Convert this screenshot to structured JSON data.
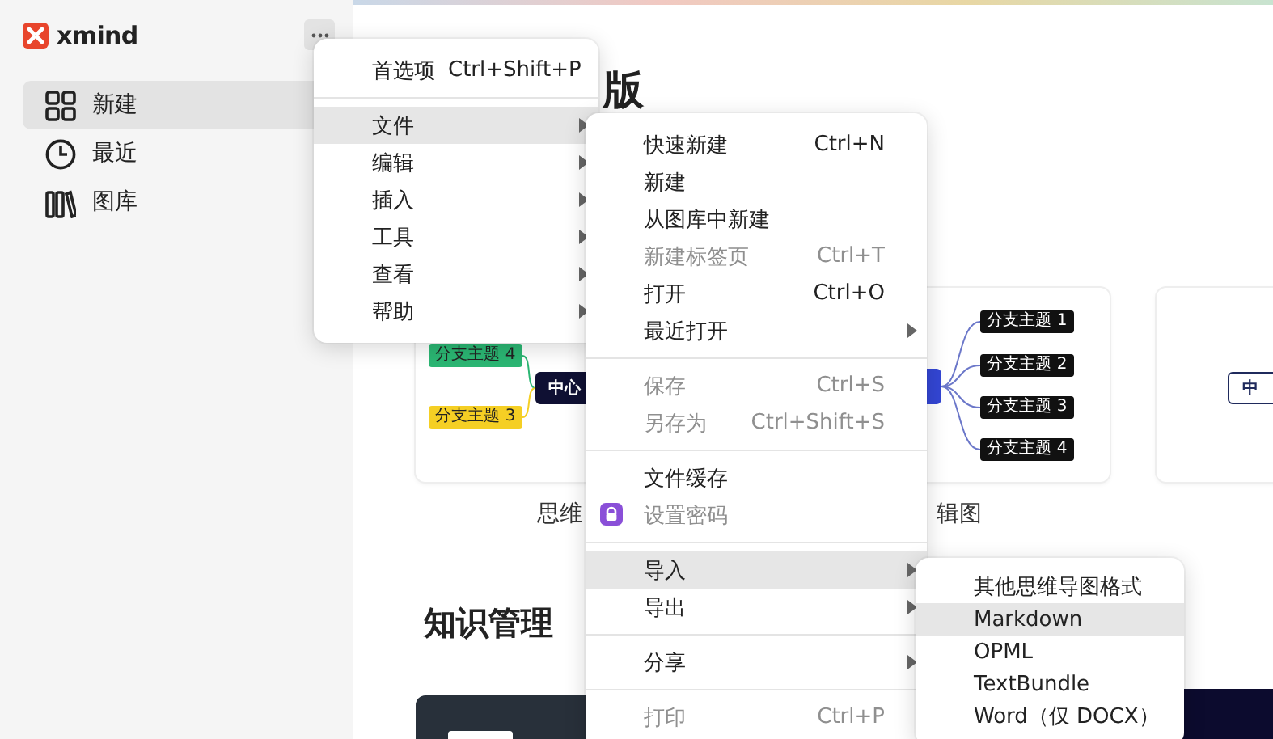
{
  "app": {
    "logo": "xmind"
  },
  "sidebar": {
    "items": [
      {
        "label": "新建",
        "kind": "new",
        "selected": true
      },
      {
        "label": "最近",
        "kind": "recent",
        "selected": false
      },
      {
        "label": "图库",
        "kind": "library",
        "selected": false
      }
    ]
  },
  "main": {
    "heading": "版",
    "templates": [
      {
        "kind": "mind-map",
        "label": "思维",
        "center": "中心",
        "branches": [
          {
            "text": "分支主题 4",
            "color": "#2bb673"
          },
          {
            "text": "分支主题 3",
            "color": "#f5cf24"
          }
        ]
      },
      {
        "kind": "logic-chart",
        "label": "辑图",
        "branches": [
          {
            "text": "分支主题 1",
            "color": "#111111"
          },
          {
            "text": "分支主题 2",
            "color": "#111111"
          },
          {
            "text": "分支主题 3",
            "color": "#111111"
          },
          {
            "text": "分支主题 4",
            "color": "#111111"
          }
        ]
      },
      {
        "kind": "outline",
        "center": "中"
      }
    ],
    "section_heading": "知识管理",
    "knowledge_cards": [
      {
        "kind": "dark"
      },
      {
        "kind": "navy"
      }
    ]
  },
  "menus": [
    {
      "items": [
        {
          "kind": "item",
          "label": "首选项",
          "shortcut": "Ctrl+Shift+P",
          "submenu": false,
          "disabled": false,
          "selected": false
        },
        {
          "kind": "separator"
        },
        {
          "kind": "item",
          "label": "文件",
          "submenu": true,
          "disabled": false,
          "selected": true
        },
        {
          "kind": "item",
          "label": "编辑",
          "submenu": true,
          "disabled": false,
          "selected": false
        },
        {
          "kind": "item",
          "label": "插入",
          "submenu": true,
          "disabled": false,
          "selected": false
        },
        {
          "kind": "item",
          "label": "工具",
          "submenu": true,
          "disabled": false,
          "selected": false
        },
        {
          "kind": "item",
          "label": "查看",
          "submenu": true,
          "disabled": false,
          "selected": false
        },
        {
          "kind": "item",
          "label": "帮助",
          "submenu": true,
          "disabled": false,
          "selected": false
        }
      ]
    },
    {
      "items": [
        {
          "kind": "item",
          "label": "快速新建",
          "shortcut": "Ctrl+N",
          "submenu": false,
          "disabled": false,
          "selected": false
        },
        {
          "kind": "item",
          "label": "新建",
          "submenu": false,
          "disabled": false,
          "selected": false
        },
        {
          "kind": "item",
          "label": "从图库中新建",
          "submenu": false,
          "disabled": false,
          "selected": false
        },
        {
          "kind": "item",
          "label": "新建标签页",
          "shortcut": "Ctrl+T",
          "submenu": false,
          "disabled": true,
          "selected": false
        },
        {
          "kind": "item",
          "label": "打开",
          "shortcut": "Ctrl+O",
          "submenu": false,
          "disabled": false,
          "selected": false
        },
        {
          "kind": "item",
          "label": "最近打开",
          "submenu": true,
          "disabled": false,
          "selected": false
        },
        {
          "kind": "separator"
        },
        {
          "kind": "item",
          "label": "保存",
          "shortcut": "Ctrl+S",
          "submenu": false,
          "disabled": true,
          "selected": false
        },
        {
          "kind": "item",
          "label": "另存为",
          "shortcut": "Ctrl+Shift+S",
          "submenu": false,
          "disabled": true,
          "selected": false
        },
        {
          "kind": "separator"
        },
        {
          "kind": "item",
          "label": "文件缓存",
          "submenu": false,
          "disabled": false,
          "selected": false
        },
        {
          "kind": "item",
          "label": "设置密码",
          "has_icon": true,
          "submenu": false,
          "disabled": true,
          "selected": false
        },
        {
          "kind": "separator"
        },
        {
          "kind": "item",
          "label": "导入",
          "submenu": true,
          "disabled": false,
          "selected": true
        },
        {
          "kind": "item",
          "label": "导出",
          "submenu": true,
          "disabled": false,
          "selected": false
        },
        {
          "kind": "separator"
        },
        {
          "kind": "item",
          "label": "分享",
          "submenu": true,
          "disabled": false,
          "selected": false
        },
        {
          "kind": "separator"
        },
        {
          "kind": "item",
          "label": "打印",
          "shortcut": "Ctrl+P",
          "submenu": false,
          "disabled": true,
          "selected": false
        }
      ]
    },
    {
      "items": [
        {
          "kind": "item",
          "label": "其他思维导图格式",
          "submenu": false,
          "disabled": false,
          "selected": false
        },
        {
          "kind": "item",
          "label": "Markdown",
          "submenu": false,
          "disabled": false,
          "selected": true
        },
        {
          "kind": "item",
          "label": "OPML",
          "submenu": false,
          "disabled": false,
          "selected": false
        },
        {
          "kind": "item",
          "label": "TextBundle",
          "submenu": false,
          "disabled": false,
          "selected": false
        },
        {
          "kind": "item",
          "label": "Word（仅 DOCX）",
          "submenu": false,
          "disabled": false,
          "selected": false
        }
      ]
    }
  ]
}
